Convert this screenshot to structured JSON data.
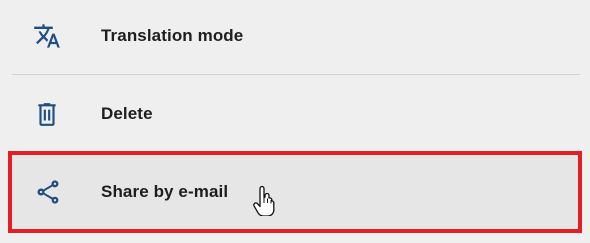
{
  "menu": {
    "items": [
      {
        "label": "Translation mode",
        "icon": "translate-icon"
      },
      {
        "label": "Delete",
        "icon": "trash-icon"
      },
      {
        "label": "Share by e-mail",
        "icon": "share-icon"
      }
    ]
  },
  "colors": {
    "background": "#efefef",
    "hover_background": "#e6e6e6",
    "highlight_border": "#e41e25",
    "icon": "#1f4f82",
    "text": "#1e1e1e"
  }
}
